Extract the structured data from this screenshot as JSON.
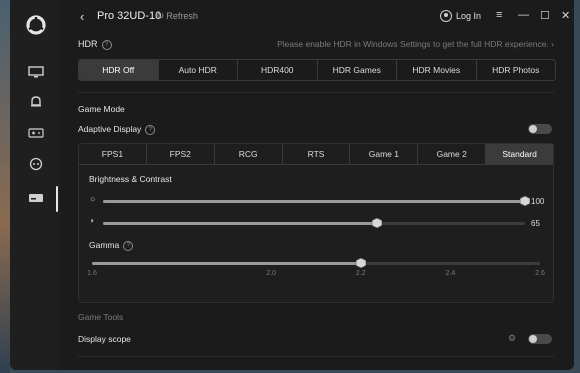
{
  "window": {
    "title": "Pro 32UD-10",
    "refresh_label": "Refresh",
    "login_label": "Log In"
  },
  "hdr": {
    "label": "HDR",
    "hint": "Please enable HDR in Windows Settings to get the full HDR experience.",
    "options": [
      "HDR Off",
      "Auto HDR",
      "HDR400",
      "HDR Games",
      "HDR Movies",
      "HDR Photos"
    ],
    "selected": "HDR Off"
  },
  "game_mode": {
    "label": "Game Mode",
    "adaptive_display_label": "Adaptive Display",
    "adaptive_display_on": false,
    "presets": [
      "FPS1",
      "FPS2",
      "RCG",
      "RTS",
      "Game 1",
      "Game 2",
      "Standard"
    ],
    "selected_preset": "Standard"
  },
  "brightness_contrast": {
    "label": "Brightness & Contrast",
    "brightness_value": "100",
    "brightness_level": 100,
    "contrast_value": "65",
    "contrast_level": 65
  },
  "gamma": {
    "label": "Gamma",
    "ticks": [
      "1.6",
      "2.0",
      "2.2",
      "2.4",
      "2.6"
    ],
    "value": 2.2
  },
  "game_tools": {
    "label": "Game Tools",
    "display_scope_label": "Display scope",
    "display_scope_on": false
  },
  "colors": {
    "window_bg": "#1b1b1c",
    "active_segment": "#3b3b3c",
    "slider_fill": "#9a9a9a"
  },
  "icons": {
    "sidebar": [
      "app-logo-icon",
      "monitor-icon",
      "bell-icon",
      "gamepad-icon",
      "controller-icon",
      "monitor-device-icon"
    ]
  }
}
